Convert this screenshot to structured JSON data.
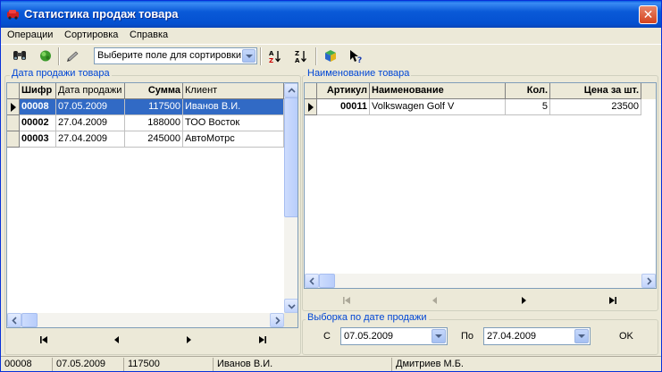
{
  "window": {
    "title": "Статистика продаж товара"
  },
  "menu": [
    "Операции",
    "Сортировка",
    "Справка"
  ],
  "toolbar": {
    "icons": [
      "binoculars-icon",
      "refresh-icon",
      "pen-icon",
      "sort-ascending-icon",
      "sort-descending-icon",
      "book-icon",
      "help-icon"
    ],
    "sort_combo": {
      "value": "Выберите поле для сортировки"
    }
  },
  "sales": {
    "group_label": "Дата продажи товара",
    "columns": [
      "Шифр",
      "Дата продажи",
      "Сумма",
      "Клиент"
    ],
    "rows": [
      {
        "code": "00008",
        "date": "07.05.2009",
        "sum": "117500",
        "client": "Иванов В.И."
      },
      {
        "code": "00002",
        "date": "27.04.2009",
        "sum": "188000",
        "client": "ТОО Восток"
      },
      {
        "code": "00003",
        "date": "27.04.2009",
        "sum": "245000",
        "client": "АвтоМотрс"
      }
    ],
    "selected_row": 0
  },
  "items": {
    "group_label": "Наименование товара",
    "columns": [
      "Артикул",
      "Наименование",
      "Кол.",
      "Цена за шт."
    ],
    "rows": [
      {
        "article": "00011",
        "name": "Volkswagen Golf V",
        "qty": "5",
        "price": "23500"
      }
    ]
  },
  "date_filter": {
    "group_label": "Выборка по дате продажи",
    "from_label": "С",
    "from_value": "07.05.2009",
    "to_label": "По",
    "to_value": "27.04.2009",
    "ok_label": "OK"
  },
  "status": {
    "panels": [
      "00008",
      "07.05.2009",
      "117500",
      "Иванов В.И.",
      "Дмитриев М.Б."
    ]
  },
  "colors": {
    "title_bar": "#0a5ad8",
    "selection": "#316ac5",
    "group_label": "#0046d5",
    "close_button": "#d4431e"
  }
}
